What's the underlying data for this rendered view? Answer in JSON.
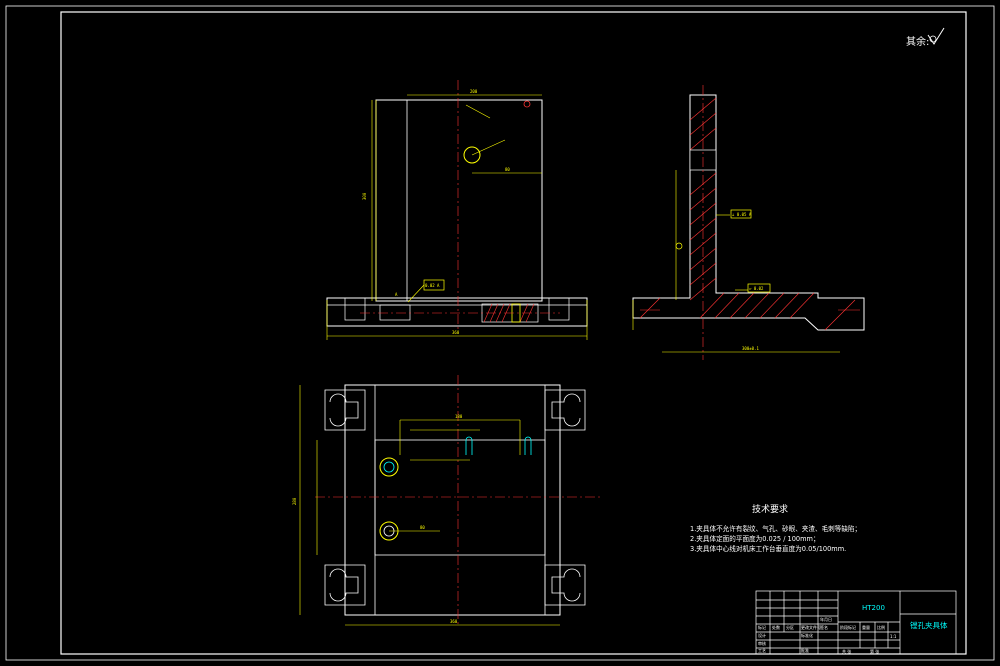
{
  "roughness_note": {
    "label": "其余:",
    "symbol": "∜"
  },
  "technical_requirements": {
    "title": "技术要求",
    "items": [
      "1.夹具体不允许有裂纹、气孔、砂眼、夹渣、毛刺等缺陷；",
      "2.夹具体定面的平面度为0.025 / 100mm；",
      "3.夹具体中心线对机床工作台垂直度为0.05/100mm."
    ]
  },
  "title_block": {
    "material": "HT200",
    "drawing_name": "镗孔夹具体",
    "scale": "1:1",
    "label_stage": "阶段标记",
    "label_weight": "重量",
    "label_scale": "比例",
    "label_design": "设计",
    "label_process": "工艺",
    "label_approve": "批准",
    "label_sheet_total": "共 张",
    "label_sheet": "第 张",
    "label_mark": "标记",
    "label_count": "处数",
    "label_zone": "分区",
    "label_change_doc": "更改文件号",
    "label_signature": "签名",
    "label_date": "年月日",
    "label_standard": "标准化",
    "label_review": "审核"
  },
  "callouts": {
    "flatness_front": "0.02 A",
    "perp_side": "⊥ 0.05 A",
    "flat_side": "▱ 0.02",
    "datum": "A"
  },
  "dimensions": {
    "front_top_width": "200",
    "front_height": "300",
    "front_base_width": "360",
    "front_hole_offset": "80",
    "side_base_width": "300±0.1",
    "plan_inner_width": "180",
    "plan_length": "360",
    "plan_height": "280",
    "plan_offset": "80"
  }
}
